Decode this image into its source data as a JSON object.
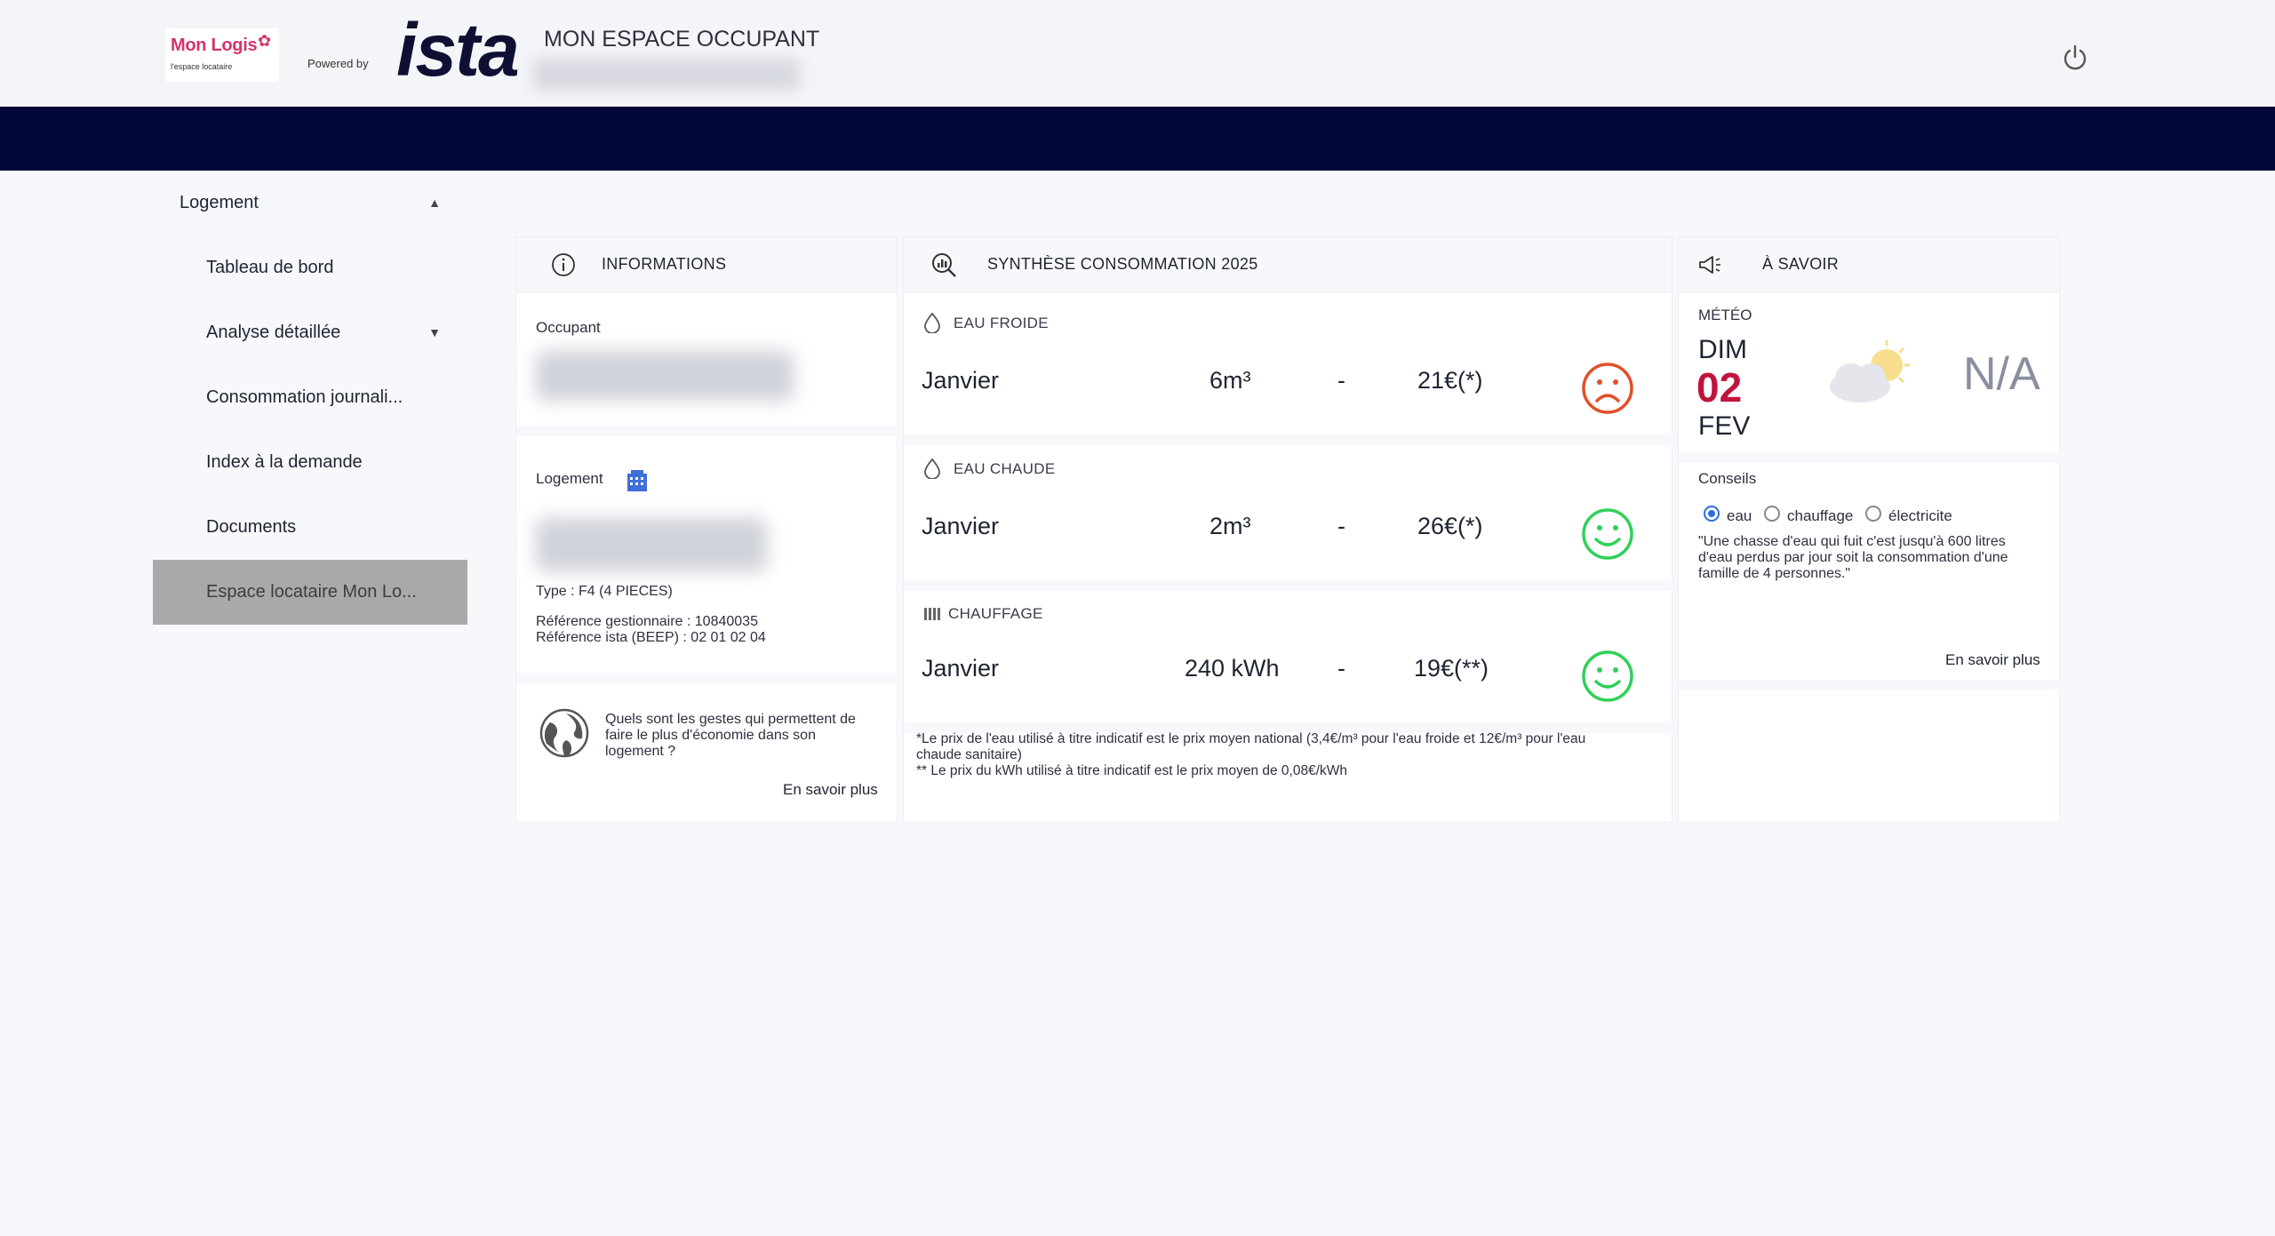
{
  "header": {
    "logo_text": "Mon Logis",
    "logo_sub": "l'espace locataire",
    "powered_by": "Powered by",
    "brand": "ista",
    "title": "MON ESPACE OCCUPANT",
    "power_icon": "power-icon"
  },
  "sidebar": {
    "items": [
      {
        "label": "Logement"
      },
      {
        "label": "Tableau de bord"
      },
      {
        "label": "Analyse détaillée"
      },
      {
        "label": "Consommation journali..."
      },
      {
        "label": "Index à la demande"
      },
      {
        "label": "Documents"
      },
      {
        "label": "Espace locataire Mon Lo..."
      }
    ]
  },
  "informations": {
    "title": "INFORMATIONS",
    "occupant_label": "Occupant",
    "logement_label": "Logement",
    "type": "Type : F4 (4 PIECES)",
    "ref_gestionnaire": "Référence gestionnaire : 10840035",
    "ref_ista": "Référence ista (BEEP) : 02 01 02 04",
    "tip_line1": "Quels sont les gestes qui permettent de",
    "tip_line2": "faire le plus d'économie dans son",
    "tip_line3": "logement ?",
    "link": "En savoir plus"
  },
  "synthese": {
    "title": "SYNTHÈSE CONSOMMATION 2025",
    "rows": [
      {
        "label": "EAU FROIDE",
        "month": "Janvier",
        "qty": "6m³",
        "sep": "-",
        "price": "21€(*)",
        "mood": "sad"
      },
      {
        "label": "EAU CHAUDE",
        "month": "Janvier",
        "qty": "2m³",
        "sep": "-",
        "price": "26€(*)",
        "mood": "happy"
      },
      {
        "label": "CHAUFFAGE",
        "month": "Janvier",
        "qty": "240 kWh",
        "sep": "-",
        "price": "19€(**)",
        "mood": "happy"
      }
    ],
    "note1a": "*Le prix de l'eau utilisé à titre indicatif est le prix moyen national (3,4€/m³ pour l'eau froide et 12€/m³ pour l'eau",
    "note1b": "chaude sanitaire)",
    "note2": "** Le prix du kWh utilisé à titre indicatif est le prix moyen de 0,08€/kWh"
  },
  "a_savoir": {
    "title": "À SAVOIR",
    "meteo_label": "MÉTÉO",
    "day": "DIM",
    "date": "02",
    "month": "FEV",
    "temp": "N/A",
    "conseils_label": "Conseils",
    "options": [
      "eau",
      "chauffage",
      "électricite"
    ],
    "selected": "eau",
    "tip_line1": "\"Une chasse d'eau qui fuit c'est jusqu'à 600 litres",
    "tip_line2": "d'eau perdus par jour soit la consommation d'une",
    "tip_line3": "famille de 4 personnes.\"",
    "link": "En savoir plus"
  },
  "colors": {
    "navy": "#020638",
    "sad": "#e0502a",
    "happy": "#2ed158",
    "date_red": "#c0143c"
  }
}
